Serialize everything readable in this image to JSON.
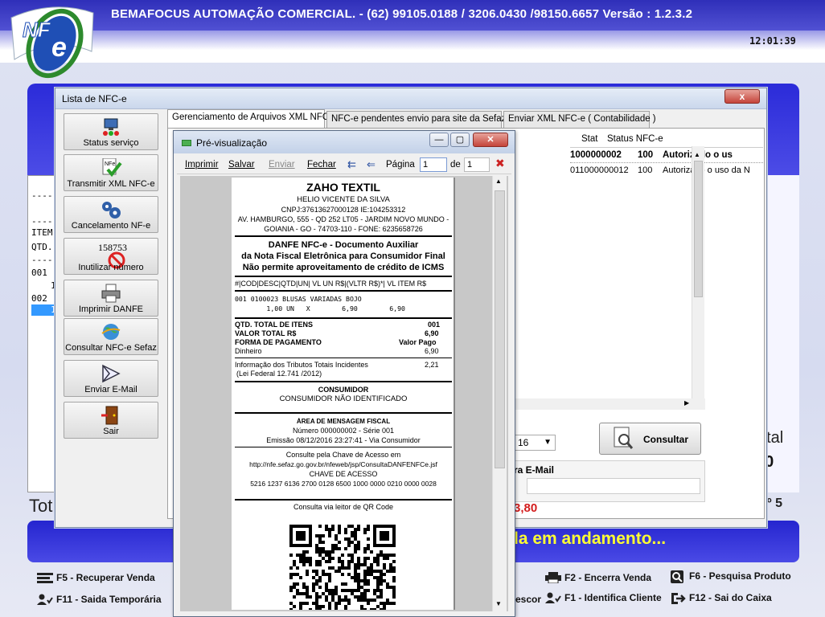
{
  "app": {
    "title": "BEMAFOCUS AUTOMAÇÃO COMERCIAL. - (62) 99105.0188  / 3206.0430 /98150.6657   Versão : 1.2.3.2",
    "clock": "12:01:39",
    "logo_text": "NF-e",
    "total_label": "Tot",
    "total_value_right": "00",
    "total_label_right": "otal",
    "item_label_right": "nº 5",
    "status_message": "da em andamento...",
    "receipt_lines": [
      "----",
      "----",
      "ITEM",
      "QTD.",
      "----",
      "001",
      "1",
      "002",
      "1"
    ],
    "function_keys": {
      "f5": "F5 - Recuperar Venda",
      "f11": "F11 - Saida Temporária",
      "f2": "F2 - Encerra Venda",
      "f6": "F6 - Pesquisa Produto",
      "desc": "escor",
      "f1": "F1 - Identifica Cliente",
      "f12": "F12 - Sai do Caixa"
    }
  },
  "lista": {
    "title": "Lista de NFC-e",
    "close_glyph": "x",
    "buttons": [
      {
        "label": "Status serviço",
        "icon": "network-status-icon"
      },
      {
        "label": "Transmitir XML NFC-e",
        "icon": "nfe-check-icon"
      },
      {
        "label": "Cancelamento NF-e",
        "icon": "gears-icon"
      },
      {
        "label": "Inutilizar número",
        "icon": "forbidden-number-icon",
        "icon_text": "158753"
      },
      {
        "label": "Imprimir DANFE",
        "icon": "printer-icon"
      },
      {
        "label": "Consultar NFC-e Sefaz",
        "icon": "globe-icon"
      },
      {
        "label": "Enviar E-Mail",
        "icon": "envelope-icon"
      },
      {
        "label": "Sair",
        "icon": "door-exit-icon"
      }
    ],
    "tabs": [
      "Gerenciamento de Arquivos XML NFC-e",
      "NFC-e  pendentes envio para site da Sefaz",
      "Enviar XML NFC-e ( Contabilidade  )"
    ],
    "grid": {
      "headers": [
        "Stat",
        "Status NFC-e"
      ],
      "rows": [
        {
          "key": "1000000002",
          "stat": "100",
          "status": "Autorizado o us",
          "selected": true
        },
        {
          "key": "011000000012",
          "stat": "100",
          "status": "Autorizado o uso da N",
          "selected": false
        }
      ]
    },
    "date_value": "16",
    "consultar_label": "Consultar",
    "email_label": "ra E-Mail",
    "total_value": "3,80"
  },
  "preview": {
    "title": "Pré-visualização",
    "minimize": "—",
    "maximize": "▢",
    "close": "✕",
    "toolbar": {
      "print": "Imprimir",
      "save": "Salvar",
      "send": "Enviar",
      "close": "Fechar",
      "page_label": "Página",
      "page_value": "1",
      "of_label": "de",
      "page_total": "1"
    },
    "receipt": {
      "company": "ZAHO TEXTIL",
      "owner": "HELIO VICENTE DA SILVA",
      "cnpj": "CNPJ:37613627000128 IE:104253312",
      "address": "AV. HAMBURGO, 555 - QD 252 LT05 - JARDIM NOVO MUNDO -",
      "city": "GOIANIA - GO - 74703-110 - FONE: 6235658726",
      "danfe1": "DANFE NFC-e - Documento Auxiliar",
      "danfe2": "da Nota Fiscal Eletrônica para Consumidor Final",
      "danfe3": "Não permite aproveitamento de crédito de ICMS",
      "col_header": "#|COD|DESC|QTD|UN| VL UN R$|(VLTR R$)*| VL ITEM R$",
      "item_line1": "001 0100023 BLUSAS VARIADAS BOJO",
      "item_line2": "        1,00 UN   X        6,90        6,90",
      "qtd_label": "QTD. TOTAL DE ITENS",
      "qtd_value": "001",
      "total_label": "VALOR TOTAL R$",
      "total_value": "6,90",
      "forma_label": "FORMA DE PAGAMENTO",
      "valor_pago_label": "Valor Pago",
      "dinheiro_label": "Dinheiro",
      "dinheiro_value": "6,90",
      "tributos1": "Informação dos Tributos Totais Incidentes",
      "tributos2": "(Lei Federal 12.741 /2012)",
      "tributos_value": "2,21",
      "consumidor_title": "CONSUMIDOR",
      "consumidor_value": "CONSUMIDOR NÃO IDENTIFICADO",
      "area_msg": "ÁREA DE MENSAGEM FISCAL",
      "numero": "Número 000000002 - Série 001",
      "emissao": "Emissão 08/12/2016 23:27:41 - Via Consumidor",
      "consulte": "Consulte pela Chave de Acesso em",
      "url": "http://nfe.sefaz.go.gov.br/nfeweb/jsp/ConsultaDANFENFCe.jsf",
      "chave_label": "CHAVE DE ACESSO",
      "chave": "5216 1237 6136 2700 0128 6500 1000 0000 0210 0000 0028",
      "qr_label": "Consulta via leitor de QR Code"
    }
  },
  "colors": {
    "header_blue": "#2f2fb9",
    "status_yellow": "#ffff33",
    "total_red": "#d31c1c"
  }
}
